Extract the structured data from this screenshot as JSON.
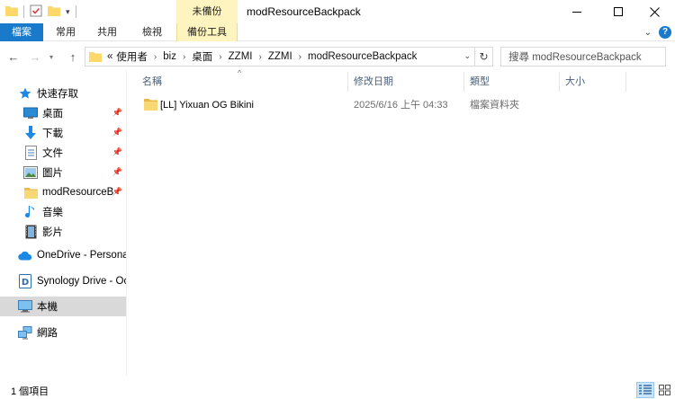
{
  "window": {
    "title": "modResourceBackpack",
    "context_tab_label": "未備份"
  },
  "ribbon": {
    "tabs": [
      "檔案",
      "常用",
      "共用",
      "檢視",
      "備份工具"
    ]
  },
  "address": {
    "overflow": "«",
    "crumbs": [
      "使用者",
      "biz",
      "桌面",
      "ZZMI",
      "ZZMI",
      "modResourceBackpack"
    ]
  },
  "search": {
    "placeholder": "搜尋 modResourceBackpack"
  },
  "nav_pane": {
    "quick_access": "快速存取",
    "quick_items": [
      "桌面",
      "下載",
      "文件",
      "圖片",
      "modResourceB",
      "音樂",
      "影片"
    ],
    "onedrive": "OneDrive - Personal",
    "synology": "Synology Drive - Oc",
    "this_pc": "本機",
    "network": "網路"
  },
  "columns": {
    "name": "名稱",
    "date": "修改日期",
    "type": "類型",
    "size": "大小"
  },
  "files": [
    {
      "name": "[LL] Yixuan OG Bikini",
      "date": "2025/6/16 上午 04:33",
      "type": "檔案資料夾",
      "size": ""
    }
  ],
  "status": {
    "item_count": "1 個項目"
  },
  "colors": {
    "file_tab": "#1979ca",
    "context_tab": "#fdf4bf",
    "folder": "#f8d775",
    "selection": "#d9d9d9"
  }
}
